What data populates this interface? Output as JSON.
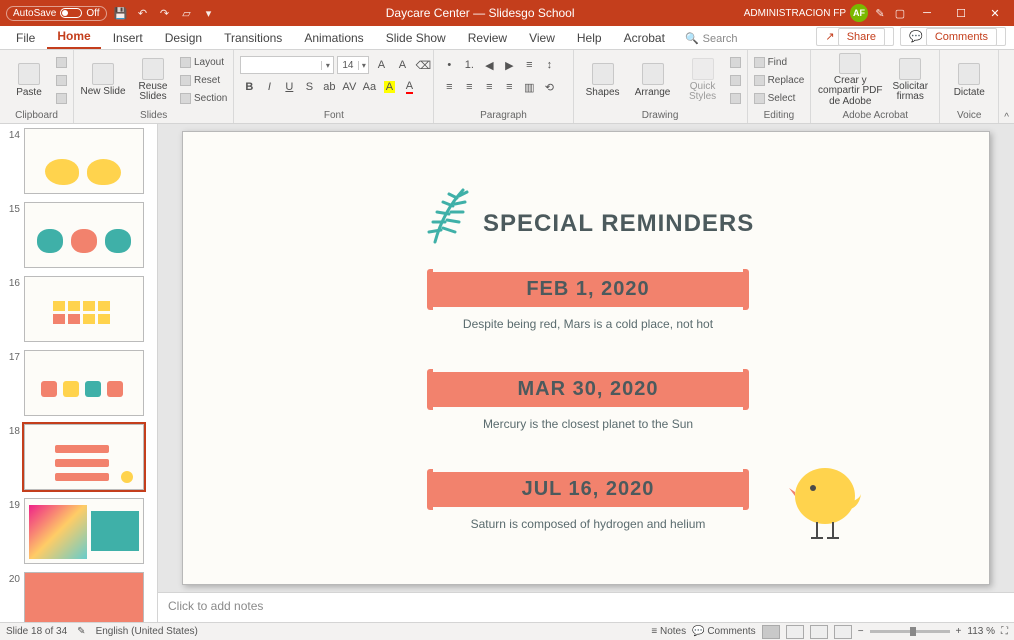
{
  "titlebar": {
    "autosave": "AutoSave",
    "autosave_state": "Off",
    "title": "Daycare Center — Slidesgo School",
    "user": "ADMINISTRACION FP",
    "avatar": "AF"
  },
  "tabs": {
    "file": "File",
    "home": "Home",
    "insert": "Insert",
    "design": "Design",
    "transitions": "Transitions",
    "animations": "Animations",
    "slideshow": "Slide Show",
    "review": "Review",
    "view": "View",
    "help": "Help",
    "acrobat": "Acrobat",
    "search": "Search",
    "share": "Share",
    "comments": "Comments"
  },
  "ribbon": {
    "paste": "Paste",
    "clipboard": "Clipboard",
    "newslide": "New Slide",
    "reuse": "Reuse Slides",
    "layout": "Layout",
    "reset": "Reset",
    "section": "Section",
    "slides": "Slides",
    "font": "Font",
    "fontsize": "14",
    "paragraph": "Paragraph",
    "shapes": "Shapes",
    "arrange": "Arrange",
    "quick": "Quick Styles",
    "drawing": "Drawing",
    "find": "Find",
    "replace": "Replace",
    "select": "Select",
    "editing": "Editing",
    "adobe1": "Crear y compartir PDF de Adobe",
    "adobe2": "Solicitar firmas",
    "adobegrp": "Adobe Acrobat",
    "dictate": "Dictate",
    "voice": "Voice"
  },
  "thumbs": [
    {
      "n": "14"
    },
    {
      "n": "15"
    },
    {
      "n": "16"
    },
    {
      "n": "17"
    },
    {
      "n": "18"
    },
    {
      "n": "19"
    },
    {
      "n": "20"
    }
  ],
  "slide": {
    "title": "SPECIAL REMINDERS",
    "items": [
      {
        "date": "FEB 1, 2020",
        "desc": "Despite being red, Mars is a cold place, not hot"
      },
      {
        "date": "MAR 30, 2020",
        "desc": "Mercury is the closest planet to the Sun"
      },
      {
        "date": "JUL 16, 2020",
        "desc": "Saturn is composed of hydrogen and helium"
      }
    ]
  },
  "notes_placeholder": "Click to add notes",
  "status": {
    "slideinfo": "Slide 18 of 34",
    "lang": "English (United States)",
    "notes": "Notes",
    "comments": "Comments",
    "zoom": "113 %"
  }
}
